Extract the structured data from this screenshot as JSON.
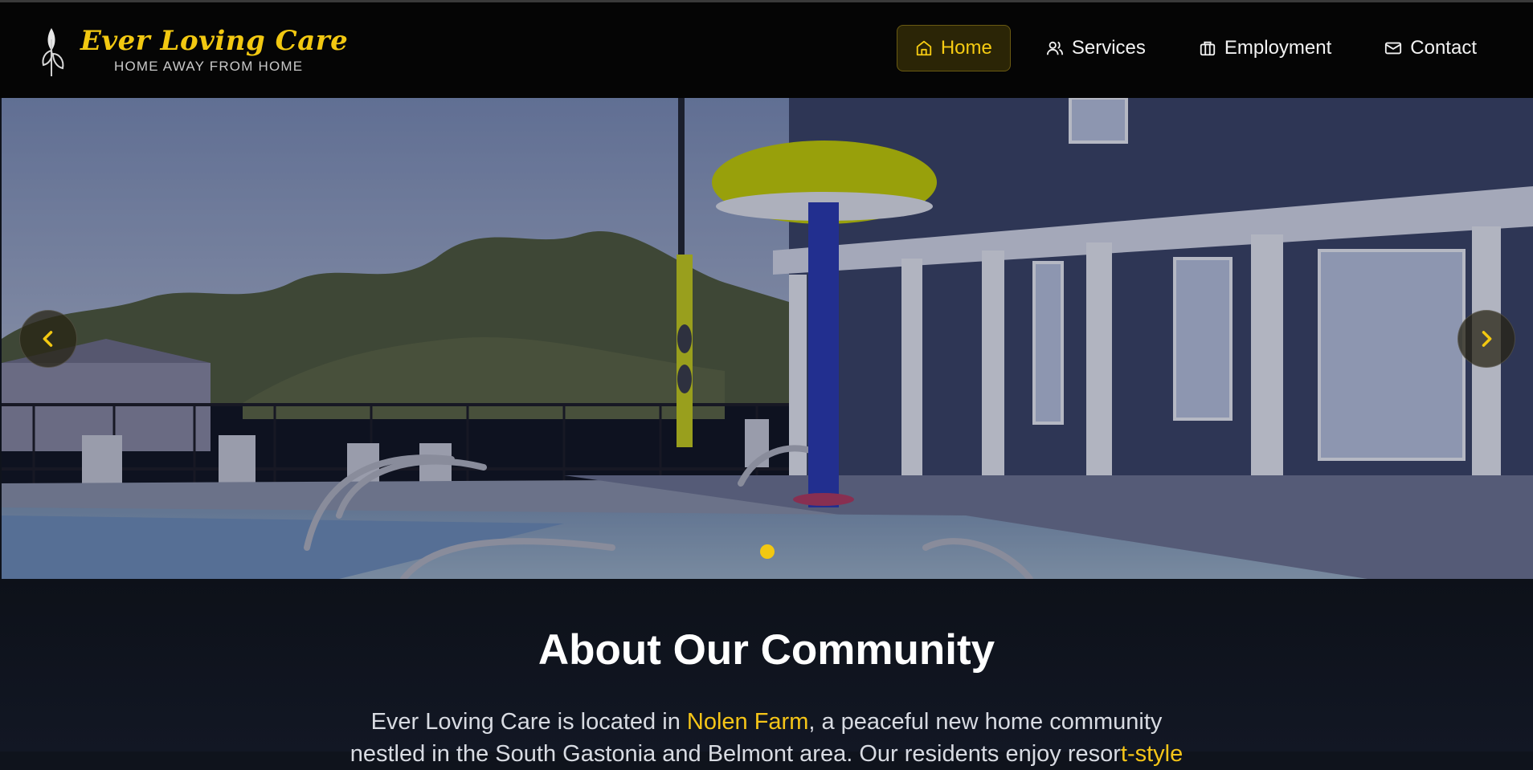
{
  "brand": {
    "title": "Ever Loving Care",
    "tagline": "HOME AWAY FROM HOME",
    "logo_icon": "wheat-leaf-icon"
  },
  "nav": {
    "items": [
      {
        "label": "Home",
        "icon": "home-icon",
        "active": true
      },
      {
        "label": "Services",
        "icon": "users-icon",
        "active": false
      },
      {
        "label": "Employment",
        "icon": "briefcase-icon",
        "active": false
      },
      {
        "label": "Contact",
        "icon": "mail-icon",
        "active": false
      }
    ]
  },
  "carousel": {
    "slide_count": 1,
    "active_index": 0,
    "prev_icon": "chevron-left-icon",
    "next_icon": "chevron-right-icon"
  },
  "about": {
    "heading": "About Our Community",
    "text_before": "Ever Loving Care is located in ",
    "highlight": "Nolen Farm",
    "text_after": ", a peaceful new home community",
    "line2_before": "nestled in the South Gastonia and Belmont area. Our residents enjoy resor",
    "line2_highlight": "t-style"
  },
  "colors": {
    "accent": "#f2c811",
    "header_bg": "#050505",
    "page_bg": "#0f131c"
  }
}
